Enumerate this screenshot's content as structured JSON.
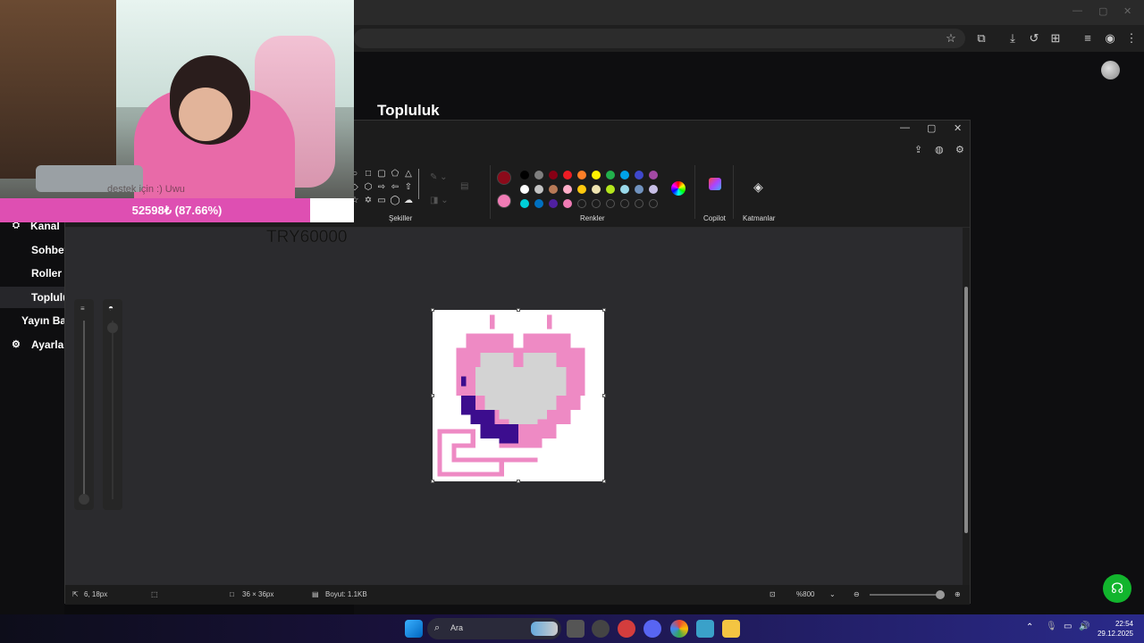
{
  "browser": {
    "toolbar_icons": [
      "star-icon",
      "extensions-icon",
      "download-icon",
      "history-icon",
      "translate-icon",
      "tab-search-icon",
      "profile-icon",
      "menu-icon"
    ]
  },
  "stream_page": {
    "section_title": "Topluluk",
    "sidebar": [
      {
        "label": "Kanal",
        "icon": "channel-icon"
      },
      {
        "label": "Sohbet"
      },
      {
        "label": "Roller"
      },
      {
        "label": "Topluluk",
        "active": true
      },
      {
        "label": "Yayın Bağ"
      },
      {
        "label": "Ayarlar",
        "icon": "gear-icon"
      }
    ]
  },
  "overlay": {
    "donation_message": "destek için :) Uwu",
    "donation_progress_text": "52598₺ (87.66%)",
    "donation_progress": 0.8766,
    "goal_text": "TRY60000",
    "accent_color": "#de4fb2"
  },
  "paint": {
    "groups": {
      "shapes": "Şekiller",
      "colors": "Renkler",
      "copilot": "Copilot",
      "layers": "Katmanlar"
    },
    "primary_color": "#8b0a1a",
    "secondary_color": "#f07cb5",
    "palette_row1": [
      "#000000",
      "#7f7f7f",
      "#880015",
      "#ed1c24",
      "#ff7f27",
      "#fff200",
      "#22b14c",
      "#00a2e8",
      "#3f48cc",
      "#a349a4"
    ],
    "palette_row2": [
      "#ffffff",
      "#c3c3c3",
      "#b97a57",
      "#ffaec9",
      "#ffc90e",
      "#efe4b0",
      "#b5e61d",
      "#99d9ea",
      "#7092be",
      "#c8bfe7"
    ],
    "palette_row3": [
      "#00d0d8",
      "#0070c0",
      "#5020a0",
      "#f07cb5",
      "",
      "",
      "",
      "",
      "",
      ""
    ],
    "status": {
      "cursor_position": "6, 18px",
      "canvas_size": "36 × 36px",
      "file_size": "Boyut: 1.1KB",
      "zoom": "%800"
    }
  },
  "taskbar": {
    "search_placeholder": "Ara",
    "time": "22:54",
    "date": "29.12.2025"
  }
}
